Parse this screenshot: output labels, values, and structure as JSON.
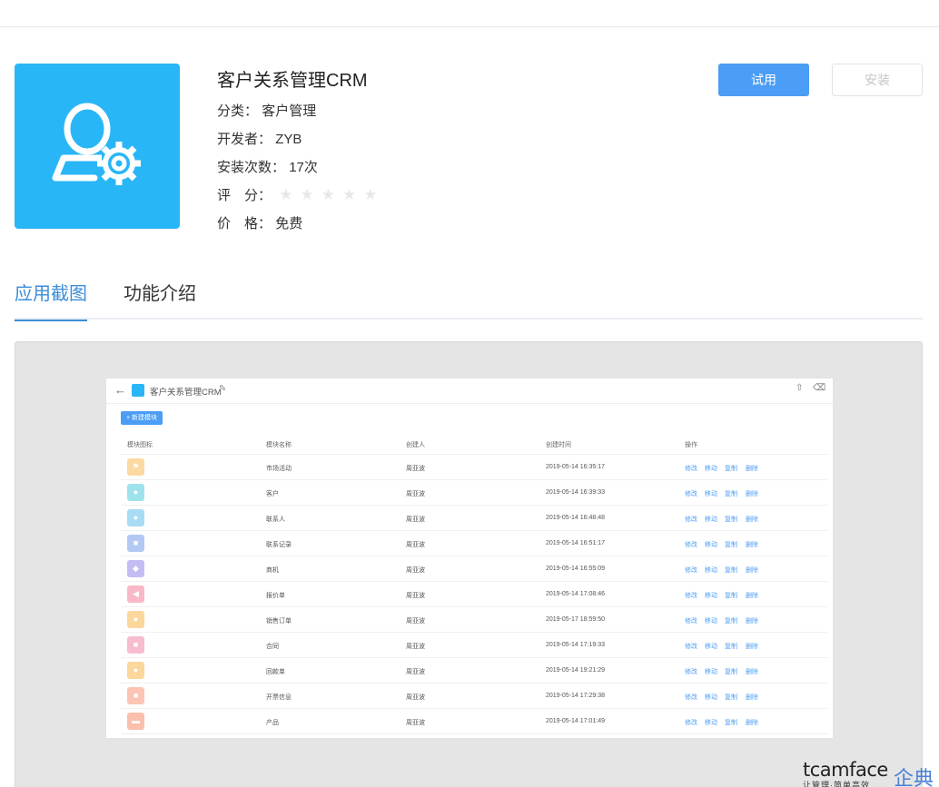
{
  "app": {
    "title": "客户关系管理CRM",
    "category_label": "分类：",
    "category_value": "客户管理",
    "developer_label": "开发者：",
    "developer_value": "ZYB",
    "installs_label": "安装次数：",
    "installs_value": "17次",
    "rating_label": "评　分：",
    "rating_value": 0,
    "rating_max": 5,
    "price_label": "价　格：",
    "price_value": "免费",
    "icon": "user-gear-icon",
    "icon_color": "#29b6f6"
  },
  "actions": {
    "try_label": "试用",
    "install_label": "安装",
    "try_color": "#4b9df5"
  },
  "tabs": [
    {
      "label": "应用截图",
      "active": true
    },
    {
      "label": "功能介绍",
      "active": false
    }
  ],
  "screenshot": {
    "title": "客户关系管理CRM",
    "new_button": "+ 新建模块",
    "columns": [
      "模块图标",
      "模块名称",
      "创建人",
      "创建时间",
      "操作"
    ],
    "actions": [
      "修改",
      "移动",
      "复制",
      "删除"
    ],
    "rows": [
      {
        "name": "市场活动",
        "creator": "周亚波",
        "time": "2019-05-14 16:35:17",
        "icon_color": "#fcd9a0",
        "glyph": "⚑"
      },
      {
        "name": "客户",
        "creator": "周亚波",
        "time": "2019-05-14 16:39:33",
        "icon_color": "#9ee3ec",
        "glyph": "●"
      },
      {
        "name": "联系人",
        "creator": "周亚波",
        "time": "2019-05-14 16:48:48",
        "icon_color": "#a8dcf4",
        "glyph": "●"
      },
      {
        "name": "联系记录",
        "creator": "周亚波",
        "time": "2019-05-14 16:51:17",
        "icon_color": "#b3c9f4",
        "glyph": "■"
      },
      {
        "name": "商机",
        "creator": "周亚波",
        "time": "2019-05-14 16:55:09",
        "icon_color": "#c4bdf3",
        "glyph": "◆"
      },
      {
        "name": "报价单",
        "creator": "周亚波",
        "time": "2019-05-14 17:08:46",
        "icon_color": "#f9b8c8",
        "glyph": "◀"
      },
      {
        "name": "销售订单",
        "creator": "周亚波",
        "time": "2019-05-17 18:59:50",
        "icon_color": "#fcd79b",
        "glyph": "●"
      },
      {
        "name": "合同",
        "creator": "周亚波",
        "time": "2019-05-14 17:19:33",
        "icon_color": "#f8bccf",
        "glyph": "■"
      },
      {
        "name": "回款单",
        "creator": "周亚波",
        "time": "2019-05-14 19:21:29",
        "icon_color": "#fcd79b",
        "glyph": "●"
      },
      {
        "name": "开票信息",
        "creator": "周亚波",
        "time": "2019-05-14 17:29:38",
        "icon_color": "#fbc4b4",
        "glyph": "■"
      },
      {
        "name": "产品",
        "creator": "周亚波",
        "time": "2019-05-14 17:01:49",
        "icon_color": "#fbbfae",
        "glyph": "▬"
      }
    ]
  },
  "watermark": {
    "brand": "tcamface",
    "brand_cn": "企典",
    "slogan": "让管理·简单高效"
  }
}
